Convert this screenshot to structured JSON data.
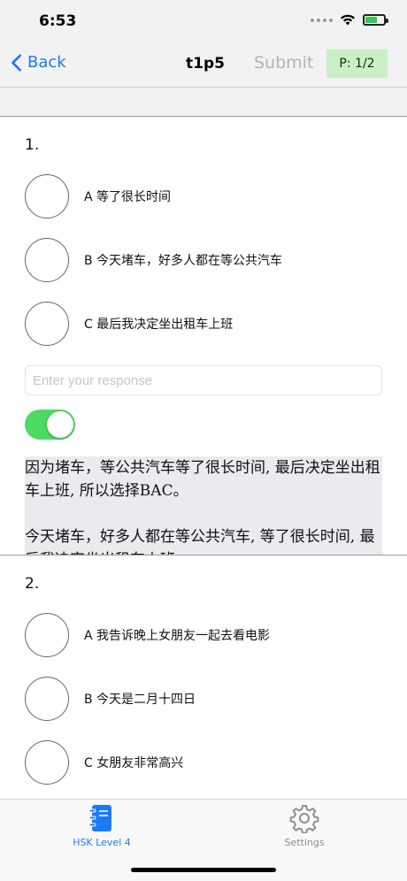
{
  "status": {
    "time": "6:53"
  },
  "nav": {
    "back_label": "Back",
    "title": "t1p5",
    "submit_label": "Submit",
    "page_badge": "P: 1/2"
  },
  "questions": [
    {
      "number": "1.",
      "options": [
        {
          "label": "A 等了很长时间"
        },
        {
          "label": "B 今天堵车，好多人都在等公共汽车"
        },
        {
          "label": "C 最后我决定坐出租车上班"
        }
      ],
      "response_placeholder": "Enter your response",
      "response_value": "",
      "show_explanation": true,
      "explanation_lines": [
        "因为堵车，等公共汽车等了很长时间, 最后决定坐出租车上班, 所以选择BAC。",
        "今天堵车，好多人都在等公共汽车, 等了很长时间, 最后我决定坐出租车上班。..."
      ]
    },
    {
      "number": "2.",
      "options": [
        {
          "label": "A 我告诉晚上女朋友一起去看电影"
        },
        {
          "label": "B 今天是二月十四日"
        },
        {
          "label": "C 女朋友非常高兴"
        }
      ]
    }
  ],
  "tabs": [
    {
      "label": "HSK Level 4",
      "icon": "notebook-icon",
      "active": true
    },
    {
      "label": "Settings",
      "icon": "gear-icon",
      "active": false
    }
  ],
  "colors": {
    "accent": "#1a7cf5",
    "toggle_on": "#4cd964",
    "badge_bg": "#c9efc5",
    "explanation_bg": "#eaeaef"
  }
}
